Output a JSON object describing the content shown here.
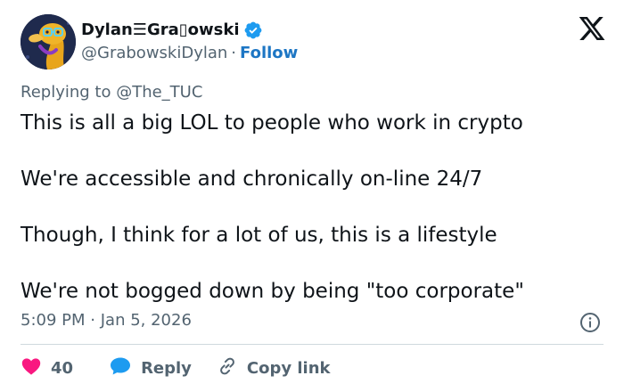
{
  "colors": {
    "text": "#0f1419",
    "secondary": "#536471",
    "link": "#1d76c4",
    "like": "#f91880",
    "reply": "#1d9bf0",
    "verified": "#1d9bf0",
    "divider": "#cfd9de"
  },
  "icons": {
    "avatar": "duck-avatar",
    "verified": "verified-badge-icon",
    "platform": "x-logo-icon",
    "info": "info-icon",
    "like": "heart-icon",
    "reply": "speech-bubble-icon",
    "copy": "link-icon"
  },
  "author": {
    "name": "Dylan☰Gra▯owski",
    "handle": "@GrabowskiDylan",
    "separator": "·",
    "follow_label": "Follow"
  },
  "tweet": {
    "replying_to_prefix": "Replying to ",
    "replying_to_handle": "@The_TUC",
    "lines": [
      "This is all a big LOL to people who work in crypto",
      "We're accessible and chronically on-line 24/7",
      "Though, I think for a lot of us, this is a lifestyle",
      "We're not bogged down by being \"too corporate\""
    ],
    "time": "5:09 PM",
    "date_separator": "·",
    "date": "Jan 5, 2026"
  },
  "actions": {
    "likes": "40",
    "reply_label": "Reply",
    "copy_label": "Copy link"
  }
}
